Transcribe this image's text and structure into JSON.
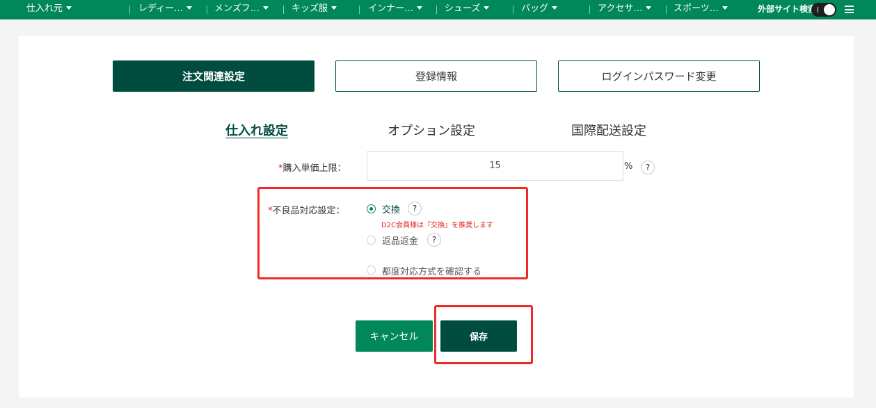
{
  "nav": {
    "items": [
      {
        "label": "仕入れ元"
      },
      {
        "label": "レディー…"
      },
      {
        "label": "メンズフ…"
      },
      {
        "label": "キッズ服"
      },
      {
        "label": "インナー…"
      },
      {
        "label": "シューズ"
      },
      {
        "label": "バッグ"
      },
      {
        "label": "アクセサ…"
      },
      {
        "label": "スポーツ…"
      }
    ],
    "external_search_label": "外部サイト検索",
    "external_search_on": true
  },
  "tabs": [
    {
      "label": "注文関連設定",
      "active": true
    },
    {
      "label": "登録情報",
      "active": false
    },
    {
      "label": "ログインパスワード変更",
      "active": false
    }
  ],
  "sub_tabs": [
    {
      "label": "仕入れ設定",
      "active": true
    },
    {
      "label": "オプション設定",
      "active": false
    },
    {
      "label": "国際配送設定",
      "active": false
    }
  ],
  "form": {
    "price_limit": {
      "required_mark": "*",
      "label": "購入単価上限：",
      "value": "15",
      "unit": "%",
      "help": "?"
    },
    "defect_handling": {
      "required_mark": "*",
      "label": "不良品対応設定：",
      "options": [
        {
          "label": "交換",
          "checked": true,
          "help": "?",
          "hint": "D2C会員様は『交換』を推奨します"
        },
        {
          "label": "返品返金",
          "checked": false,
          "help": "?"
        },
        {
          "label": "都度対応方式を確認する",
          "checked": false
        }
      ]
    }
  },
  "buttons": {
    "cancel": "キャンセル",
    "save": "保存"
  },
  "colors": {
    "nav_green": "#00875a",
    "dark_green": "#004d40",
    "highlight_red": "#ee2a24",
    "required_red": "#e0241f"
  }
}
